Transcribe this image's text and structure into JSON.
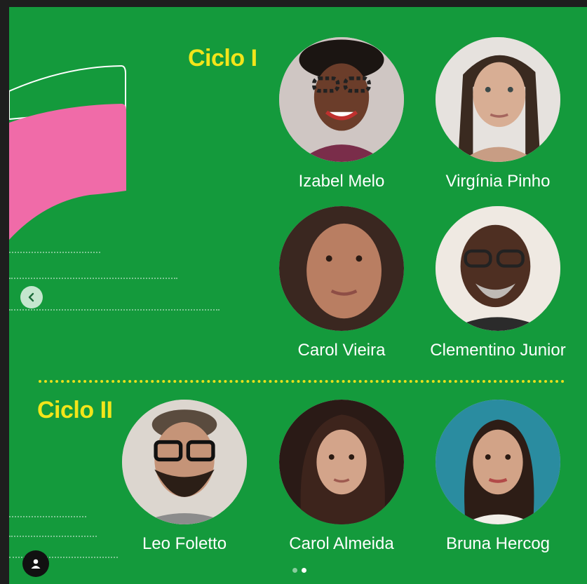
{
  "colors": {
    "background": "#149a3c",
    "heading": "#f2e51a",
    "accent_pink": "#f06ba8",
    "name_text": "#ffffff"
  },
  "sections": [
    {
      "title": "Ciclo I"
    },
    {
      "title": "Ciclo II"
    }
  ],
  "people": [
    {
      "name": "Izabel Melo",
      "photo": "avatar-photo"
    },
    {
      "name": "Virgínia Pinho",
      "photo": "avatar-photo"
    },
    {
      "name": "Carol Vieira",
      "photo": "avatar-photo"
    },
    {
      "name": "Clementino Junior",
      "photo": "avatar-photo"
    },
    {
      "name": "Leo Foletto",
      "photo": "avatar-photo"
    },
    {
      "name": "Carol Almeida",
      "photo": "avatar-photo"
    },
    {
      "name": "Bruna Hercog",
      "photo": "avatar-photo"
    }
  ],
  "controls": {
    "prev_icon": "chevron-left-icon",
    "profile_icon": "user-icon",
    "pager": {
      "current": 2,
      "total": 2
    }
  }
}
